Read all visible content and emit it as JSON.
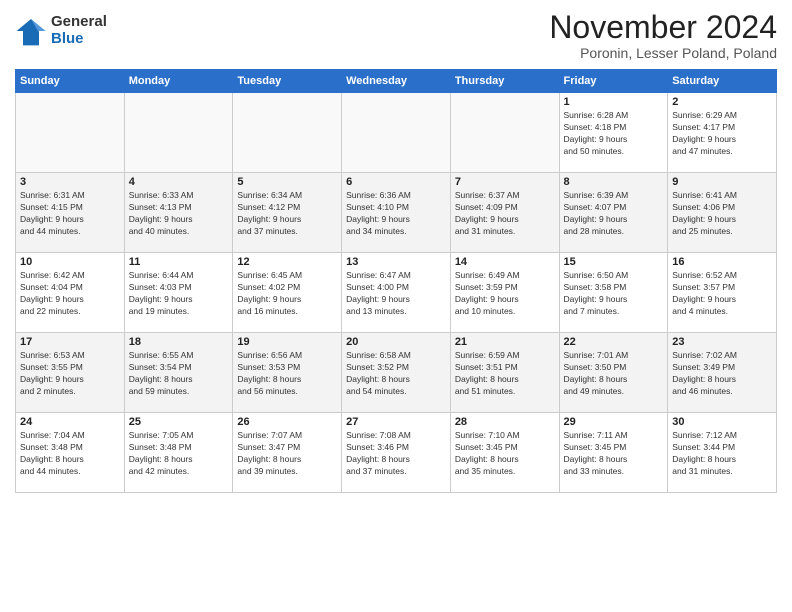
{
  "logo": {
    "general": "General",
    "blue": "Blue"
  },
  "header": {
    "month": "November 2024",
    "location": "Poronin, Lesser Poland, Poland"
  },
  "weekdays": [
    "Sunday",
    "Monday",
    "Tuesday",
    "Wednesday",
    "Thursday",
    "Friday",
    "Saturday"
  ],
  "weeks": [
    [
      {
        "day": "",
        "info": ""
      },
      {
        "day": "",
        "info": ""
      },
      {
        "day": "",
        "info": ""
      },
      {
        "day": "",
        "info": ""
      },
      {
        "day": "",
        "info": ""
      },
      {
        "day": "1",
        "info": "Sunrise: 6:28 AM\nSunset: 4:18 PM\nDaylight: 9 hours\nand 50 minutes."
      },
      {
        "day": "2",
        "info": "Sunrise: 6:29 AM\nSunset: 4:17 PM\nDaylight: 9 hours\nand 47 minutes."
      }
    ],
    [
      {
        "day": "3",
        "info": "Sunrise: 6:31 AM\nSunset: 4:15 PM\nDaylight: 9 hours\nand 44 minutes."
      },
      {
        "day": "4",
        "info": "Sunrise: 6:33 AM\nSunset: 4:13 PM\nDaylight: 9 hours\nand 40 minutes."
      },
      {
        "day": "5",
        "info": "Sunrise: 6:34 AM\nSunset: 4:12 PM\nDaylight: 9 hours\nand 37 minutes."
      },
      {
        "day": "6",
        "info": "Sunrise: 6:36 AM\nSunset: 4:10 PM\nDaylight: 9 hours\nand 34 minutes."
      },
      {
        "day": "7",
        "info": "Sunrise: 6:37 AM\nSunset: 4:09 PM\nDaylight: 9 hours\nand 31 minutes."
      },
      {
        "day": "8",
        "info": "Sunrise: 6:39 AM\nSunset: 4:07 PM\nDaylight: 9 hours\nand 28 minutes."
      },
      {
        "day": "9",
        "info": "Sunrise: 6:41 AM\nSunset: 4:06 PM\nDaylight: 9 hours\nand 25 minutes."
      }
    ],
    [
      {
        "day": "10",
        "info": "Sunrise: 6:42 AM\nSunset: 4:04 PM\nDaylight: 9 hours\nand 22 minutes."
      },
      {
        "day": "11",
        "info": "Sunrise: 6:44 AM\nSunset: 4:03 PM\nDaylight: 9 hours\nand 19 minutes."
      },
      {
        "day": "12",
        "info": "Sunrise: 6:45 AM\nSunset: 4:02 PM\nDaylight: 9 hours\nand 16 minutes."
      },
      {
        "day": "13",
        "info": "Sunrise: 6:47 AM\nSunset: 4:00 PM\nDaylight: 9 hours\nand 13 minutes."
      },
      {
        "day": "14",
        "info": "Sunrise: 6:49 AM\nSunset: 3:59 PM\nDaylight: 9 hours\nand 10 minutes."
      },
      {
        "day": "15",
        "info": "Sunrise: 6:50 AM\nSunset: 3:58 PM\nDaylight: 9 hours\nand 7 minutes."
      },
      {
        "day": "16",
        "info": "Sunrise: 6:52 AM\nSunset: 3:57 PM\nDaylight: 9 hours\nand 4 minutes."
      }
    ],
    [
      {
        "day": "17",
        "info": "Sunrise: 6:53 AM\nSunset: 3:55 PM\nDaylight: 9 hours\nand 2 minutes."
      },
      {
        "day": "18",
        "info": "Sunrise: 6:55 AM\nSunset: 3:54 PM\nDaylight: 8 hours\nand 59 minutes."
      },
      {
        "day": "19",
        "info": "Sunrise: 6:56 AM\nSunset: 3:53 PM\nDaylight: 8 hours\nand 56 minutes."
      },
      {
        "day": "20",
        "info": "Sunrise: 6:58 AM\nSunset: 3:52 PM\nDaylight: 8 hours\nand 54 minutes."
      },
      {
        "day": "21",
        "info": "Sunrise: 6:59 AM\nSunset: 3:51 PM\nDaylight: 8 hours\nand 51 minutes."
      },
      {
        "day": "22",
        "info": "Sunrise: 7:01 AM\nSunset: 3:50 PM\nDaylight: 8 hours\nand 49 minutes."
      },
      {
        "day": "23",
        "info": "Sunrise: 7:02 AM\nSunset: 3:49 PM\nDaylight: 8 hours\nand 46 minutes."
      }
    ],
    [
      {
        "day": "24",
        "info": "Sunrise: 7:04 AM\nSunset: 3:48 PM\nDaylight: 8 hours\nand 44 minutes."
      },
      {
        "day": "25",
        "info": "Sunrise: 7:05 AM\nSunset: 3:48 PM\nDaylight: 8 hours\nand 42 minutes."
      },
      {
        "day": "26",
        "info": "Sunrise: 7:07 AM\nSunset: 3:47 PM\nDaylight: 8 hours\nand 39 minutes."
      },
      {
        "day": "27",
        "info": "Sunrise: 7:08 AM\nSunset: 3:46 PM\nDaylight: 8 hours\nand 37 minutes."
      },
      {
        "day": "28",
        "info": "Sunrise: 7:10 AM\nSunset: 3:45 PM\nDaylight: 8 hours\nand 35 minutes."
      },
      {
        "day": "29",
        "info": "Sunrise: 7:11 AM\nSunset: 3:45 PM\nDaylight: 8 hours\nand 33 minutes."
      },
      {
        "day": "30",
        "info": "Sunrise: 7:12 AM\nSunset: 3:44 PM\nDaylight: 8 hours\nand 31 minutes."
      }
    ]
  ]
}
